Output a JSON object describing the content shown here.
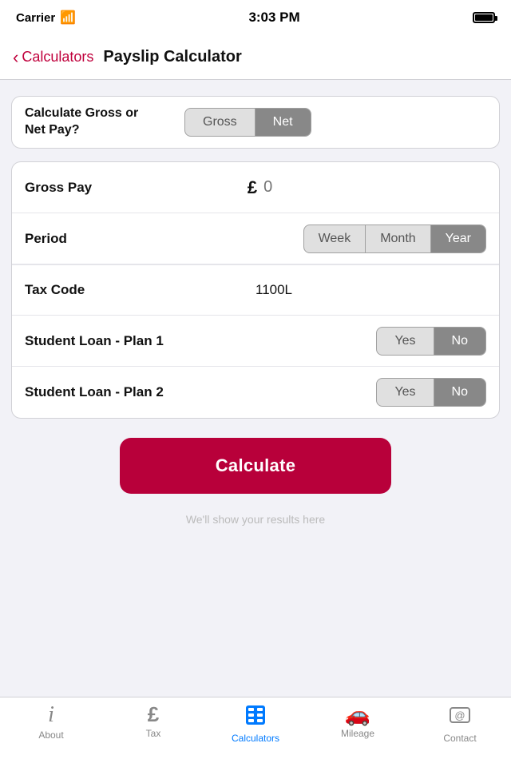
{
  "statusBar": {
    "carrier": "Carrier",
    "time": "3:03 PM"
  },
  "navBar": {
    "backLabel": "Calculators",
    "title": "Payslip Calculator"
  },
  "form": {
    "grossNetRow": {
      "label": "Calculate Gross or Net Pay?",
      "options": [
        "Gross",
        "Net"
      ],
      "selected": "Net"
    },
    "grossPayRow": {
      "label": "Gross Pay",
      "currencySymbol": "£",
      "placeholder": "0"
    },
    "periodRow": {
      "label": "Period",
      "options": [
        "Week",
        "Month",
        "Year"
      ],
      "selected": "Year"
    },
    "taxCodeRow": {
      "label": "Tax Code",
      "value": "1100L"
    },
    "studentLoan1Row": {
      "label": "Student Loan - Plan 1",
      "options": [
        "Yes",
        "No"
      ],
      "selected": "No"
    },
    "studentLoan2Row": {
      "label": "Student Loan - Plan 2",
      "options": [
        "Yes",
        "No"
      ],
      "selected": "No"
    }
  },
  "calculateButton": {
    "label": "Calculate"
  },
  "hintText": "We'll show your results here",
  "tabBar": {
    "items": [
      {
        "id": "about",
        "label": "About",
        "icon": "ℹ"
      },
      {
        "id": "tax",
        "label": "Tax",
        "icon": "£"
      },
      {
        "id": "calculators",
        "label": "Calculators",
        "icon": "⊞"
      },
      {
        "id": "mileage",
        "label": "Mileage",
        "icon": "🚗"
      },
      {
        "id": "contact",
        "label": "Contact",
        "icon": "@"
      }
    ],
    "activeTab": "calculators"
  }
}
